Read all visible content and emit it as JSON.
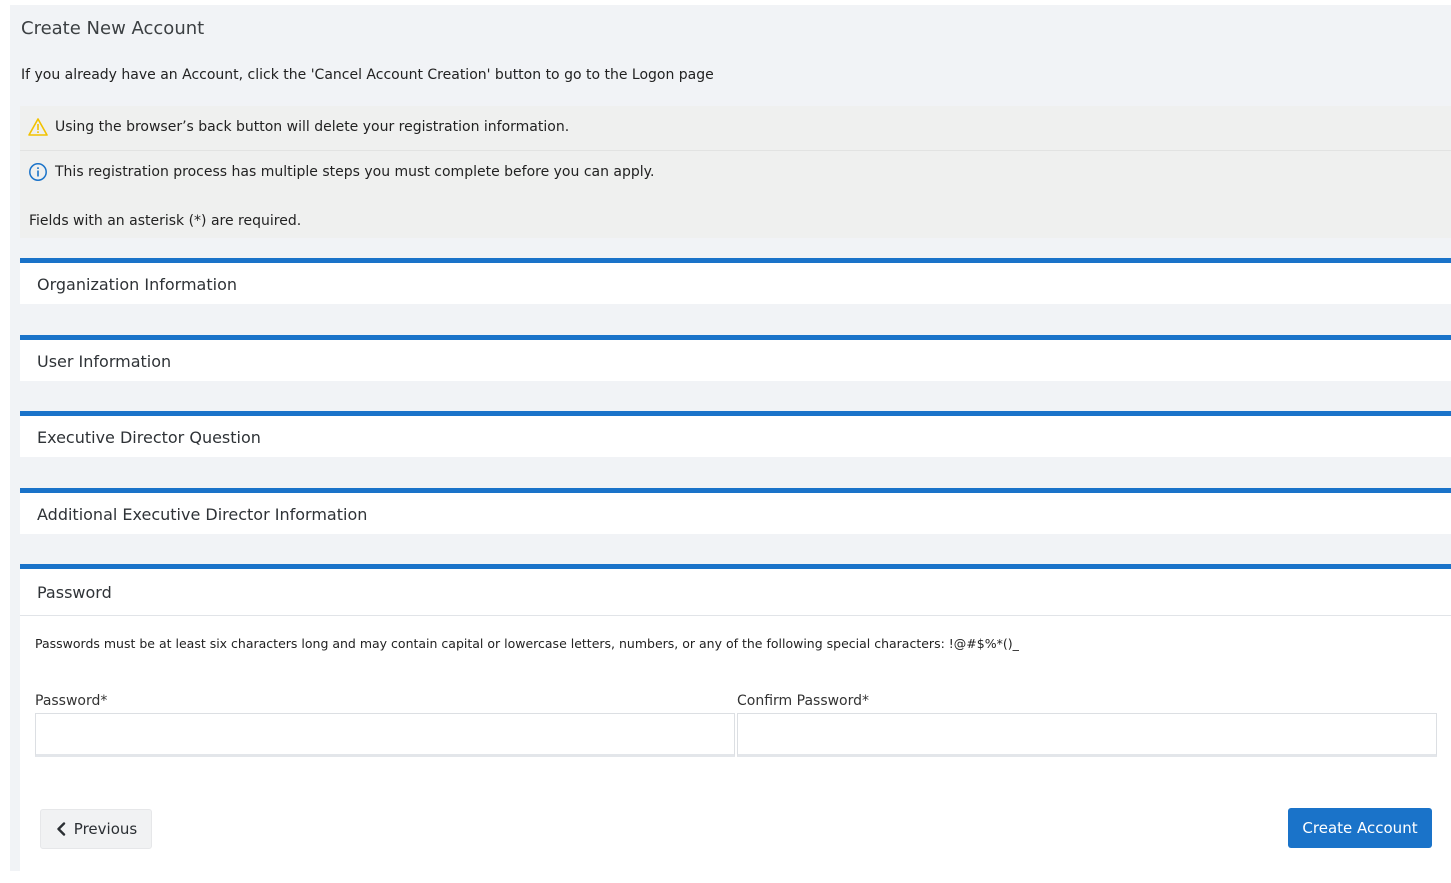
{
  "header": {
    "title": "Create New Account",
    "intro": "If you already have an Account, click the 'Cancel Account Creation' button to go to the Logon page"
  },
  "notices": {
    "warning": "Using the browser’s back button will delete your registration information.",
    "info": "This registration process has multiple steps you must complete before you can apply.",
    "required": "Fields with an asterisk (*) are required."
  },
  "sections": {
    "organization": "Organization Information",
    "user": "User Information",
    "executive_question": "Executive Director Question",
    "executive_additional": "Additional Executive Director Information"
  },
  "password": {
    "title": "Password",
    "rules": "Passwords must be at least six characters long and may contain capital or lowercase letters, numbers, or any of the following special characters: !@#$%*()_",
    "password_label": "Password*",
    "password_value": "",
    "confirm_label": "Confirm Password*",
    "confirm_value": ""
  },
  "actions": {
    "previous_label": "Previous",
    "create_label": "Create Account"
  },
  "colors": {
    "accent": "#1a73c9",
    "warning_icon": "#f2c200",
    "info_icon": "#1a73c9"
  },
  "icons": {
    "warning": "warning-triangle-icon",
    "info": "info-circle-icon",
    "previous": "chevron-left-icon"
  }
}
